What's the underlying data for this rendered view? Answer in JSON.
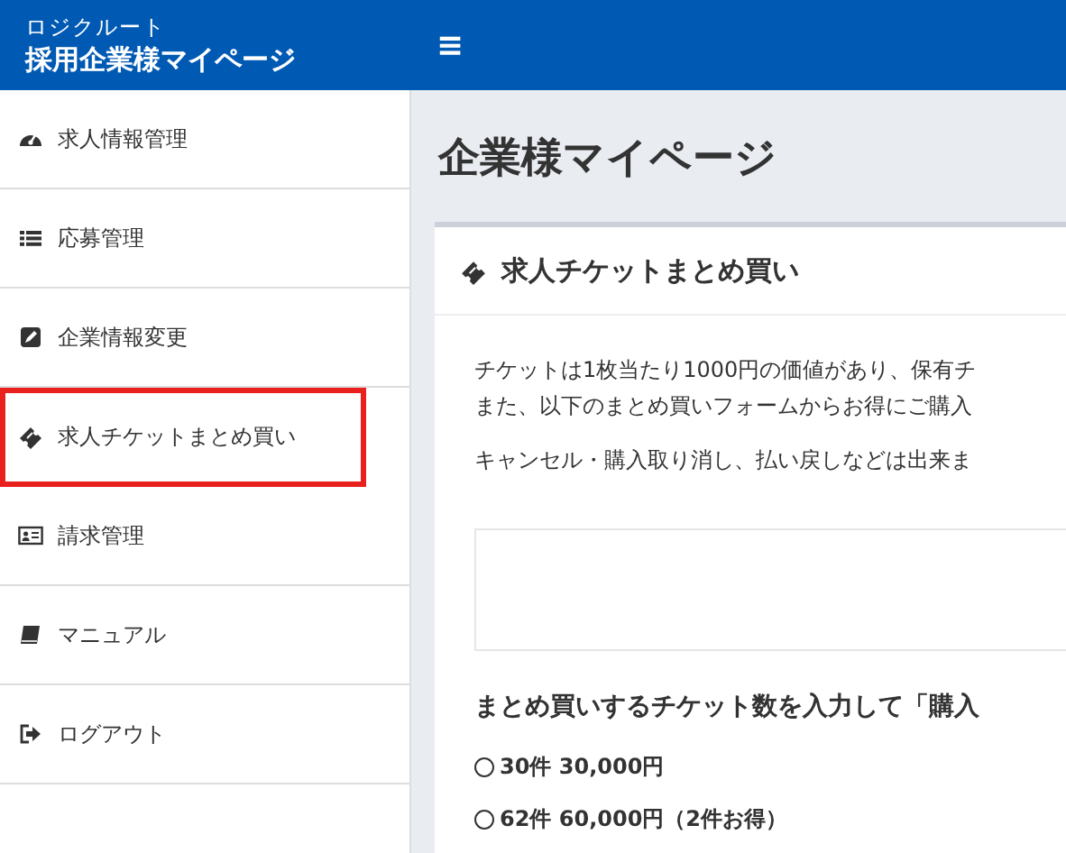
{
  "header": {
    "brand_sub": "ロジクルート",
    "brand_title": "採用企業様マイページ",
    "menu_icon": "≡"
  },
  "sidebar": {
    "items": [
      {
        "label": "求人情報管理",
        "selected": false
      },
      {
        "label": "応募管理",
        "selected": false
      },
      {
        "label": "企業情報変更",
        "selected": false
      },
      {
        "label": "求人チケットまとめ買い",
        "selected": true
      },
      {
        "label": "請求管理",
        "selected": false
      },
      {
        "label": "マニュアル",
        "selected": false
      },
      {
        "label": "ログアウト",
        "selected": false
      }
    ]
  },
  "page_title": "企業様マイページ",
  "card": {
    "title": "求人チケットまとめ買い",
    "paragraphs": [
      [
        "チケットは1枚当たり1000円の価値があり、保有チ",
        "また、以下のまとめ買いフォームからお得にご購入"
      ],
      [
        "キャンセル・購入取り消し、払い戻しなどは出来ま"
      ]
    ],
    "instruction": "まとめ買いするチケット数を入力して「購入",
    "options": [
      {
        "label": "30件  30,000円",
        "selected": false
      },
      {
        "label": "62件  60,000円（2件お得）",
        "selected": false
      }
    ]
  }
}
